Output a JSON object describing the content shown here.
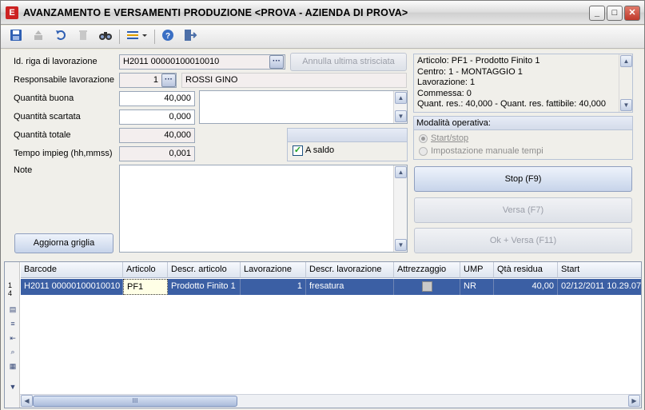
{
  "window": {
    "title": "AVANZAMENTO E VERSAMENTI PRODUZIONE <PROVA - AZIENDA DI PROVA>",
    "app_icon_letter": "E",
    "controls": {
      "minimize": "_",
      "maximize": "□",
      "close": "✕"
    }
  },
  "toolbar": {
    "icons": [
      "save-icon",
      "upload-icon",
      "undo-icon",
      "delete-icon",
      "binoculars-icon",
      "columns-icon",
      "help-icon",
      "exit-icon"
    ]
  },
  "form": {
    "id_riga_label": "Id. riga di lavorazione",
    "id_riga_value": "H2011 00000100010010",
    "annulla_label": "Annulla ultima strisciata",
    "responsabile_label": "Responsabile lavorazione",
    "responsabile_code": "1",
    "responsabile_name": "ROSSI GINO",
    "qta_buona_label": "Quantità buona",
    "qta_buona_value": "40,000",
    "qta_scartata_label": "Quantità scartata",
    "qta_scartata_value": "0,000",
    "qta_totale_label": "Quantità totale",
    "qta_totale_value": "40,000",
    "tempo_label": "Tempo impieg (hh,mmss)",
    "tempo_value": "0,001",
    "a_saldo_label": "A saldo",
    "a_saldo_checked": true,
    "note_label": "Note",
    "aggiorna_label": "Aggiorna griglia"
  },
  "info": {
    "lines": [
      "Articolo: PF1 - Prodotto Finito 1",
      "Centro: 1 - MONTAGGIO 1",
      "Lavorazione: 1",
      "Commessa: 0",
      "Quant. res.: 40,000 - Quant. res. fattibile: 40,000"
    ]
  },
  "modalita": {
    "title": "Modalità operativa:",
    "options": [
      "Start/stop",
      "Impostazione manuale tempi"
    ],
    "selected": 0
  },
  "actions": {
    "stop": "Stop (F9)",
    "versa": "Versa (F7)",
    "ok_versa": "Ok + Versa (F11)"
  },
  "grid": {
    "columns": [
      "Barcode",
      "Articolo",
      "Descr. articolo",
      "Lavorazione",
      "Descr. lavorazione",
      "Attrezzaggio",
      "UMP",
      "Qtà residua",
      "Start"
    ],
    "row_indicator": [
      "1",
      "4"
    ],
    "rows": [
      {
        "barcode": "H2011 00000100010010",
        "articolo": "PF1",
        "descr_articolo": "Prodotto Finito 1",
        "lavorazione": "1",
        "descr_lavorazione": "fresatura",
        "attrezzaggio": "",
        "ump": "NR",
        "qta_residua": "40,00",
        "start": "02/12/2011 10.29.07"
      }
    ],
    "scroll_thumb_label": "III"
  },
  "colors": {
    "selection": "#3b5fa4",
    "window_bg": "#ece9d8",
    "close_button": "#c0392b"
  }
}
